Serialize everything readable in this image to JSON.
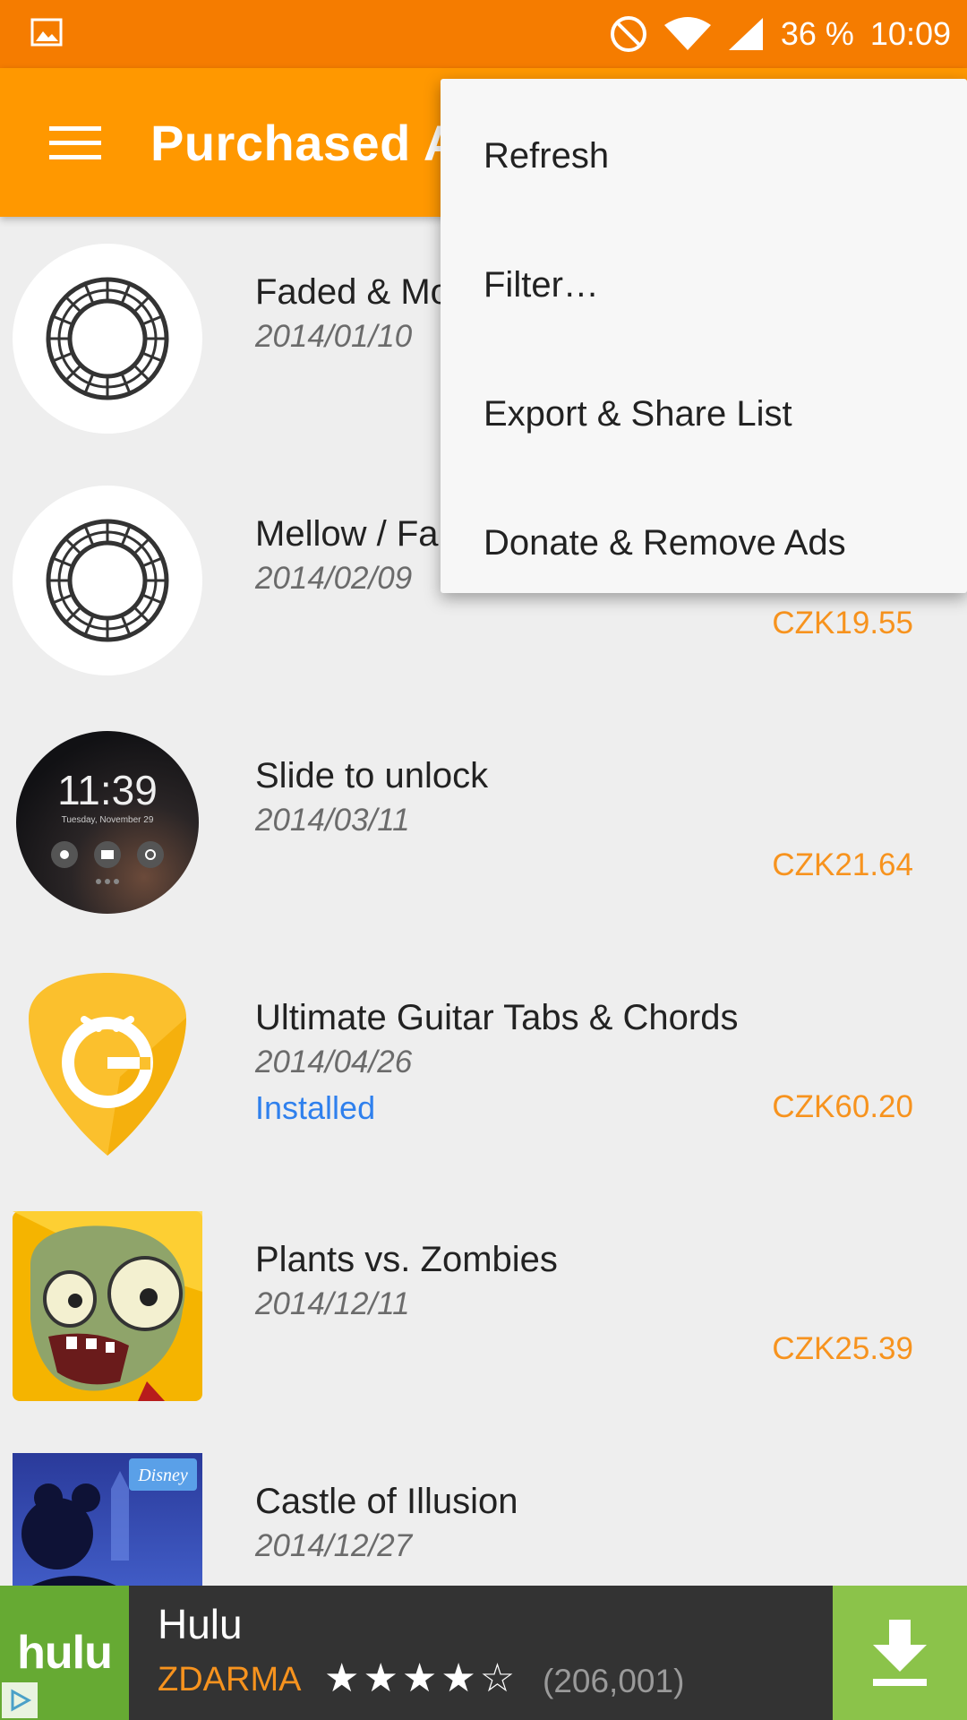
{
  "status_bar": {
    "battery": "36 %",
    "time": "10:09",
    "icons": [
      "image-icon",
      "do-not-disturb-icon",
      "wifi-icon",
      "signal-icon"
    ]
  },
  "app_bar": {
    "title": "Purchased Apps",
    "menu_icon": "hamburger-menu-icon"
  },
  "menu": {
    "items": [
      {
        "label": "Refresh"
      },
      {
        "label": "Filter…"
      },
      {
        "label": "Export & Share List"
      },
      {
        "label": "Donate & Remove Ads"
      }
    ]
  },
  "apps": [
    {
      "name": "Faded & Mo",
      "date": "2014/01/10",
      "status": "",
      "price": ""
    },
    {
      "name": "Mellow / Fa",
      "date": "2014/02/09",
      "status": "",
      "price": "CZK19.55"
    },
    {
      "name": "Slide to unlock",
      "date": "2014/03/11",
      "status": "",
      "price": "CZK21.64"
    },
    {
      "name": "Ultimate Guitar Tabs & Chords",
      "date": "2014/04/26",
      "status": "Installed",
      "price": "CZK60.20"
    },
    {
      "name": "Plants vs. Zombies",
      "date": "2014/12/11",
      "status": "",
      "price": "CZK25.39"
    },
    {
      "name": "Castle of Illusion",
      "date": "2014/12/27",
      "status": "",
      "price": ""
    }
  ],
  "icon_texts": {
    "lock_time": "11:39",
    "lock_date": "Tuesday, November 29",
    "disney": "Disney"
  },
  "ad": {
    "logo": "hulu",
    "name": "Hulu",
    "price": "ZDARMA",
    "stars": "★★★★☆",
    "reviews": "(206,001)"
  },
  "colors": {
    "status_bar": "#f57c00",
    "app_bar": "#ff9800",
    "price": "#f7931e",
    "installed": "#2f80ed",
    "ad_green": "#8bc34a"
  }
}
